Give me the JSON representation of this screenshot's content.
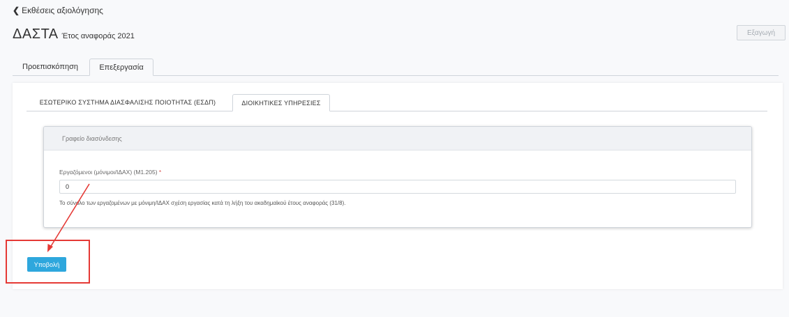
{
  "header": {
    "back_label": "Εκθέσεις αξιολόγησης",
    "title_main": "ΔΑΣΤΑ",
    "title_sub": "Έτος αναφοράς 2021",
    "export_label": "Εξαγωγή"
  },
  "top_tabs": [
    {
      "label": "Προεπισκόπηση",
      "active": false
    },
    {
      "label": "Επεξεργασία",
      "active": true
    }
  ],
  "inner_tabs": [
    {
      "label": "ΕΣΩΤΕΡΙΚΟ ΣΥΣΤΗΜΑ ΔΙΑΣΦΑΛΙΣΗΣ ΠΟΙΟΤΗΤΑΣ (ΕΣΔΠ)",
      "active": false
    },
    {
      "label": "ΔΙΟΙΚΗΤΙΚΕΣ ΥΠΗΡΕΣΙΕΣ",
      "active": true
    }
  ],
  "panel": {
    "header": "Γραφείο διασύνδεσης",
    "field_label": "Εργαζόμενοι (μόνιμοι/ΙΔΑΧ) (Μ1.205)",
    "required_mark": "*",
    "field_value": "0",
    "help_text": "Το σύνολο των εργαζομένων με μόνιμη/ΙΔΑΧ σχέση εργασίας κατά τη λήξη του ακαδημαϊκού έτους αναφοράς (31/8)."
  },
  "submit_label": "Υποβολή",
  "colors": {
    "submit": "#2ea7dd",
    "annotation": "#e53935"
  },
  "icons": {
    "back": "chevron-left-icon"
  }
}
